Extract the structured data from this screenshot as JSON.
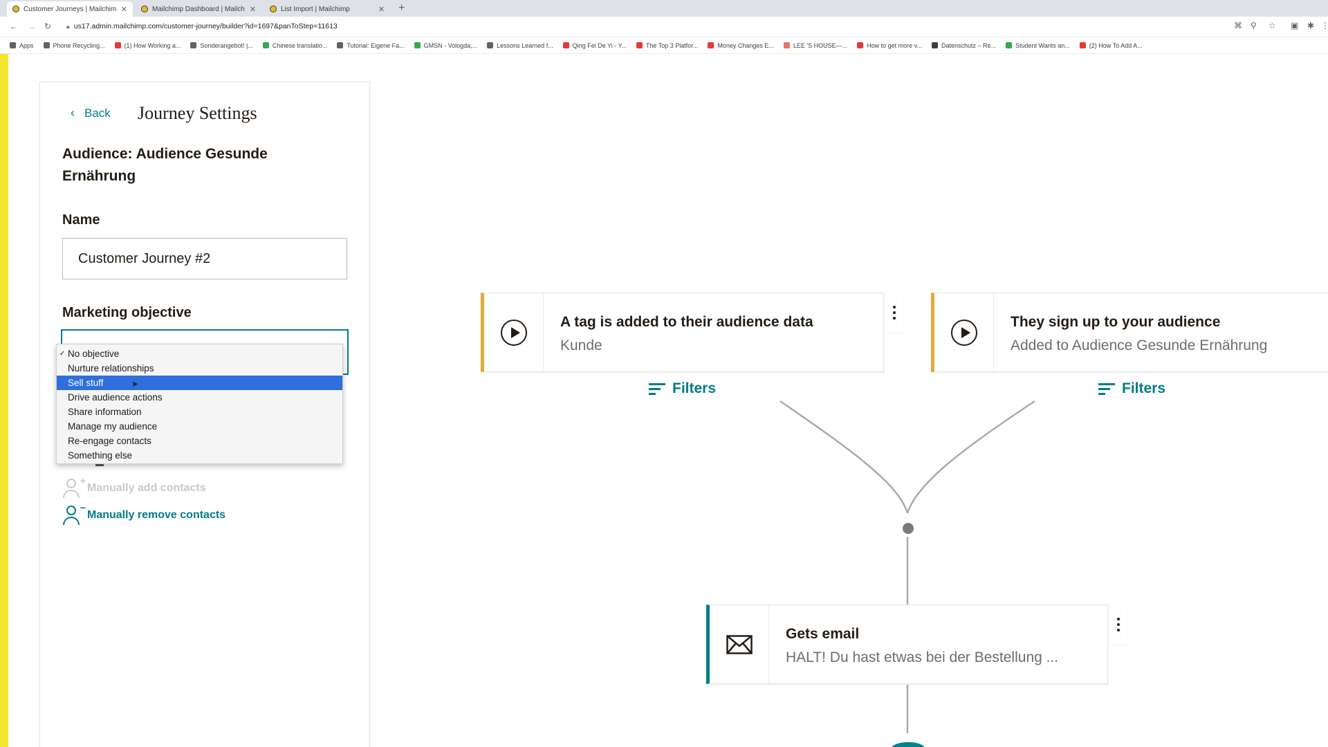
{
  "browser": {
    "tabs": [
      {
        "title": "Customer Journeys | Mailchim",
        "active": true
      },
      {
        "title": "Mailchimp Dashboard | Mailch",
        "active": false
      },
      {
        "title": "List Import | Mailchimp",
        "active": false
      }
    ],
    "new_tab": "+",
    "url": "us17.admin.mailchimp.com/customer-journey/builder?id=1697&panToStep=11613",
    "bookmarks": [
      {
        "label": "Apps",
        "color": "#5f6368"
      },
      {
        "label": "Phone Recycling...",
        "color": "#5f6368"
      },
      {
        "label": "(1) How Working a...",
        "color": "#e53935"
      },
      {
        "label": "Sonderangebot! |...",
        "color": "#5f6368"
      },
      {
        "label": "Chinese translatio...",
        "color": "#34a853"
      },
      {
        "label": "Tutorial: Eigene Fa...",
        "color": "#5f6368"
      },
      {
        "label": "GMSN - Vologda,...",
        "color": "#34a853"
      },
      {
        "label": "Lessons Learned f...",
        "color": "#5f6368"
      },
      {
        "label": "Qing Fei De Yi - Y...",
        "color": "#e53935"
      },
      {
        "label": "The Top 3 Platfor...",
        "color": "#e53935"
      },
      {
        "label": "Money Changes E...",
        "color": "#e53935"
      },
      {
        "label": "LEE 'S HOUSE—...",
        "color": "#e57373"
      },
      {
        "label": "How to get more v...",
        "color": "#e53935"
      },
      {
        "label": "Datenschutz – Re...",
        "color": "#3c4043"
      },
      {
        "label": "Student Wants an...",
        "color": "#34a853"
      },
      {
        "label": "(2) How To Add A...",
        "color": "#e53935"
      }
    ]
  },
  "panel": {
    "back_label": "Back",
    "title": "Journey Settings",
    "audience": "Audience: Audience Gesunde Ernährung",
    "name_label": "Name",
    "name_value": "Customer Journey #2",
    "objective_label": "Marketing objective",
    "objective_options": [
      "No objective",
      "Nurture relationships",
      "Sell stuff",
      "Drive audience actions",
      "Share information",
      "Manage my audience",
      "Re-engage contacts",
      "Something else"
    ],
    "objective_checked": "No objective",
    "objective_highlighted": "Sell stuff",
    "manual_add": "Manually add contacts",
    "manual_remove": "Manually remove contacts"
  },
  "canvas": {
    "trigger_1": {
      "title": "A tag is added to their audience data",
      "subtitle": "Kunde"
    },
    "trigger_2": {
      "title": "They sign up to your audience",
      "subtitle": "Added to Audience Gesunde Ernährung"
    },
    "filters_label": "Filters",
    "email_node": {
      "title": "Gets email",
      "subtitle": "HALT! Du hast etwas bei der Bestellung ..."
    }
  },
  "colors": {
    "accent": "#007c89",
    "trigger_border": "#e0ac3a",
    "highlight": "#2e6fdc",
    "mailchimp_yellow": "#f2e62c"
  }
}
